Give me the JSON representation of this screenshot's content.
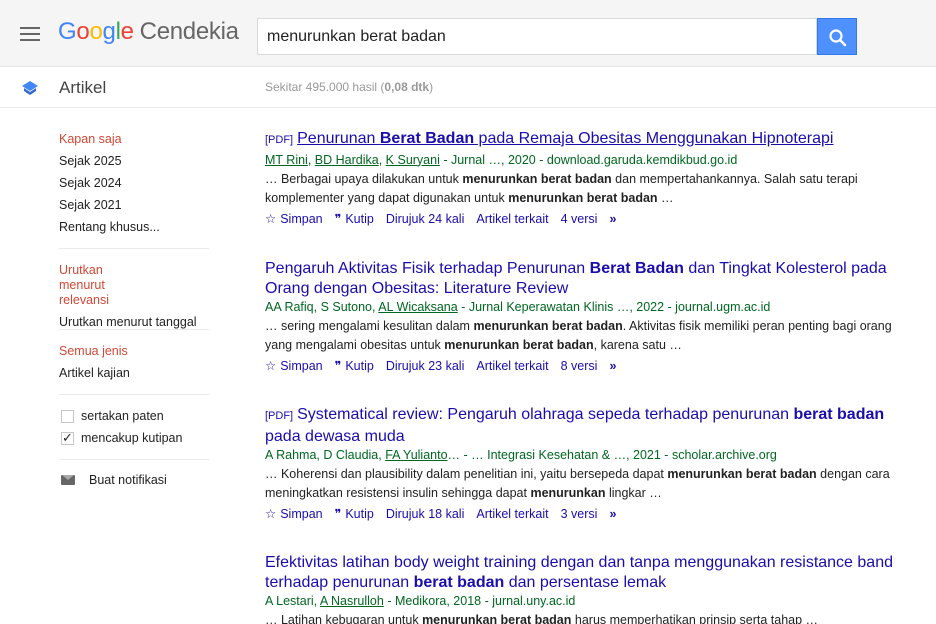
{
  "header": {
    "logo_google": [
      "G",
      "o",
      "o",
      "g",
      "l",
      "e"
    ],
    "logo_suffix": "Cendekia",
    "search_value": "menurunkan berat badan"
  },
  "subheader": {
    "section_label": "Artikel",
    "result_count_prefix": "Sekitar 495.000 hasil (",
    "result_count_time": "0,08 dtk",
    "result_count_suffix": ")"
  },
  "sidebar": {
    "time_filters": [
      "Kapan saja",
      "Sejak 2025",
      "Sejak 2024",
      "Sejak 2021",
      "Rentang khusus..."
    ],
    "sort": [
      "Urutkan menurut relevansi",
      "Urutkan menurut tanggal"
    ],
    "types": [
      "Semua jenis",
      "Artikel kajian"
    ],
    "checks": [
      {
        "label": "sertakan paten",
        "checked": false
      },
      {
        "label": "mencakup kutipan",
        "checked": true
      }
    ],
    "notification": "Buat notifikasi"
  },
  "results": [
    {
      "pdf": "[PDF]",
      "title_parts": [
        [
          "Penurunan ",
          false
        ],
        [
          "Berat Badan",
          true
        ],
        [
          " pada Remaja Obesitas Menggunakan Hipnoterapi",
          false
        ]
      ],
      "authors": [
        "MT Rini",
        "BD Hardika",
        "K Suryani"
      ],
      "source": " - Jurnal …, 2020 - download.garuda.kemdikbud.go.id",
      "snippet_parts": [
        [
          "… Berbagai upaya dilakukan untuk ",
          false
        ],
        [
          "menurunkan berat badan",
          true
        ],
        [
          " dan mempertahankannya. Salah satu terapi komplementer yang dapat digunakan untuk ",
          false
        ],
        [
          "menurunkan berat badan",
          true
        ],
        [
          " …",
          false
        ]
      ],
      "save": "Simpan",
      "cite": "Kutip",
      "cited_by": "Dirujuk 24 kali",
      "related": "Artikel terkait",
      "versions": "4 versi"
    },
    {
      "pdf": "",
      "title_parts": [
        [
          "Pengaruh Aktivitas Fisik terhadap Penurunan ",
          false
        ],
        [
          "Berat Badan",
          true
        ],
        [
          " dan Tingkat Kolesterol pada Orang dengan Obesitas: Literature Review",
          false
        ]
      ],
      "authors_plain": "AA Rafiq, S Sutono, ",
      "authors": [
        "AL Wicaksana"
      ],
      "source": " - Jurnal Keperawatan Klinis …, 2022 - journal.ugm.ac.id",
      "snippet_parts": [
        [
          "… sering mengalami kesulitan dalam ",
          false
        ],
        [
          "menurunkan berat badan",
          true
        ],
        [
          ". Aktivitas fisik memiliki peran penting bagi orang yang mengalami obesitas untuk ",
          false
        ],
        [
          "menurunkan berat badan",
          true
        ],
        [
          ", karena satu …",
          false
        ]
      ],
      "save": "Simpan",
      "cite": "Kutip",
      "cited_by": "Dirujuk 23 kali",
      "related": "Artikel terkait",
      "versions": "8 versi"
    },
    {
      "pdf": "[PDF]",
      "title_parts": [
        [
          "Systematical review: Pengaruh olahraga sepeda terhadap penurunan ",
          false
        ],
        [
          "berat badan",
          true
        ],
        [
          " pada dewasa muda",
          false
        ]
      ],
      "authors_plain": "A Rahma, D Claudia, ",
      "authors": [
        "FA Yulianto"
      ],
      "source": "… - … Integrasi Kesehatan & …, 2021 - scholar.archive.org",
      "snippet_parts": [
        [
          "… Koherensi dan plausibility dalam penelitian ini, yaitu bersepeda dapat ",
          false
        ],
        [
          "menurunkan berat badan",
          true
        ],
        [
          " dengan cara meningkatkan resistensi insulin sehingga dapat ",
          false
        ],
        [
          "menurunkan",
          true
        ],
        [
          " lingkar …",
          false
        ]
      ],
      "save": "Simpan",
      "cite": "Kutip",
      "cited_by": "Dirujuk 18 kali",
      "related": "Artikel terkait",
      "versions": "3 versi"
    },
    {
      "pdf": "",
      "title_parts": [
        [
          "Efektivitas latihan body weight training dengan dan tanpa menggunakan resistance band terhadap penurunan ",
          false
        ],
        [
          "berat badan",
          true
        ],
        [
          " dan persentase lemak",
          false
        ]
      ],
      "authors_plain": "A Lestari, ",
      "authors": [
        "A Nasrulloh"
      ],
      "source": " - Medikora, 2018 - jurnal.uny.ac.id",
      "snippet_parts": [
        [
          "… Latihan kebugaran untuk ",
          false
        ],
        [
          "menurunkan berat badan",
          true
        ],
        [
          " harus memperhatikan prinsip serta tahap …",
          false
        ]
      ],
      "save": "",
      "cite": "",
      "cited_by": "",
      "related": "",
      "versions": ""
    }
  ]
}
